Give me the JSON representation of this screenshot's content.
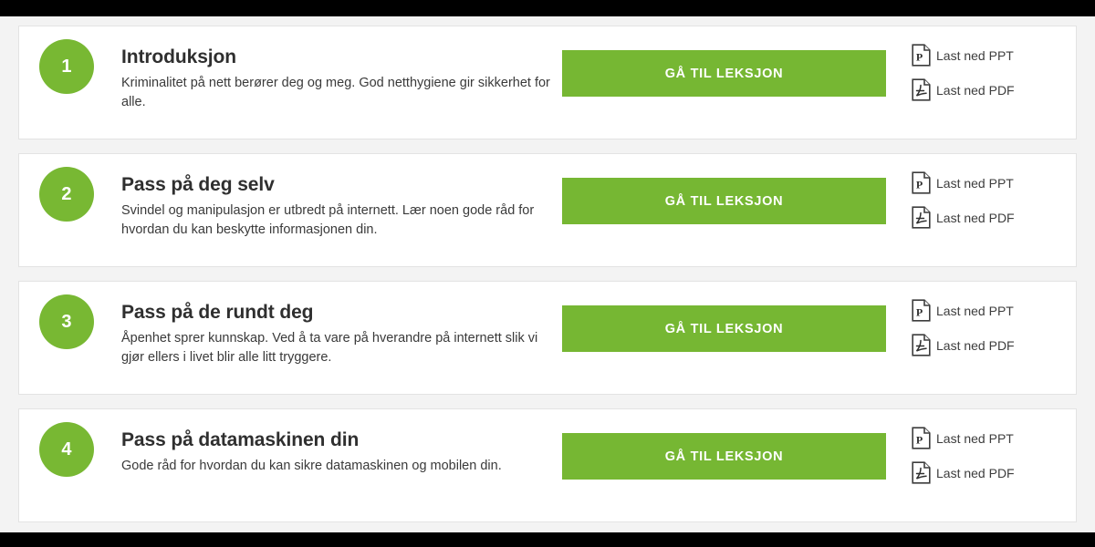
{
  "theme": {
    "accent_green": "#78b833",
    "button_green": "#76b733",
    "page_background": "#f3f3f3",
    "card_background": "#ffffff",
    "card_border": "#e3e3e3",
    "title_color": "#2f2f2f",
    "body_text_color": "#3a3a3a",
    "frame_color": "#000000"
  },
  "lessons": [
    {
      "number": "1",
      "title": "Introduksjon",
      "description": "Kriminalitet på nett berører deg og meg. God netthygiene gir sikkerhet for alle.",
      "button_label": "GÅ TIL LEKSJON",
      "downloads": [
        {
          "label": "Last ned PPT",
          "icon": "powerpoint-file-icon"
        },
        {
          "label": "Last ned PDF",
          "icon": "pdf-file-icon"
        }
      ]
    },
    {
      "number": "2",
      "title": "Pass på deg selv",
      "description": "Svindel og manipulasjon er utbredt på internett. Lær noen gode råd for hvordan du kan beskytte informasjonen din.",
      "button_label": "GÅ TIL LEKSJON",
      "downloads": [
        {
          "label": "Last ned PPT",
          "icon": "powerpoint-file-icon"
        },
        {
          "label": "Last ned PDF",
          "icon": "pdf-file-icon"
        }
      ]
    },
    {
      "number": "3",
      "title": "Pass på de rundt deg",
      "description": "Åpenhet sprer kunnskap. Ved å ta vare på hverandre på internett slik vi gjør ellers i livet blir alle litt tryggere.",
      "button_label": "GÅ TIL LEKSJON",
      "downloads": [
        {
          "label": "Last ned PPT",
          "icon": "powerpoint-file-icon"
        },
        {
          "label": "Last ned PDF",
          "icon": "pdf-file-icon"
        }
      ]
    },
    {
      "number": "4",
      "title": "Pass på datamaskinen din",
      "description": "Gode råd for hvordan du kan sikre datamaskinen og mobilen din.",
      "button_label": "GÅ TIL LEKSJON",
      "downloads": [
        {
          "label": "Last ned PPT",
          "icon": "powerpoint-file-icon"
        },
        {
          "label": "Last ned PDF",
          "icon": "pdf-file-icon"
        }
      ]
    }
  ]
}
